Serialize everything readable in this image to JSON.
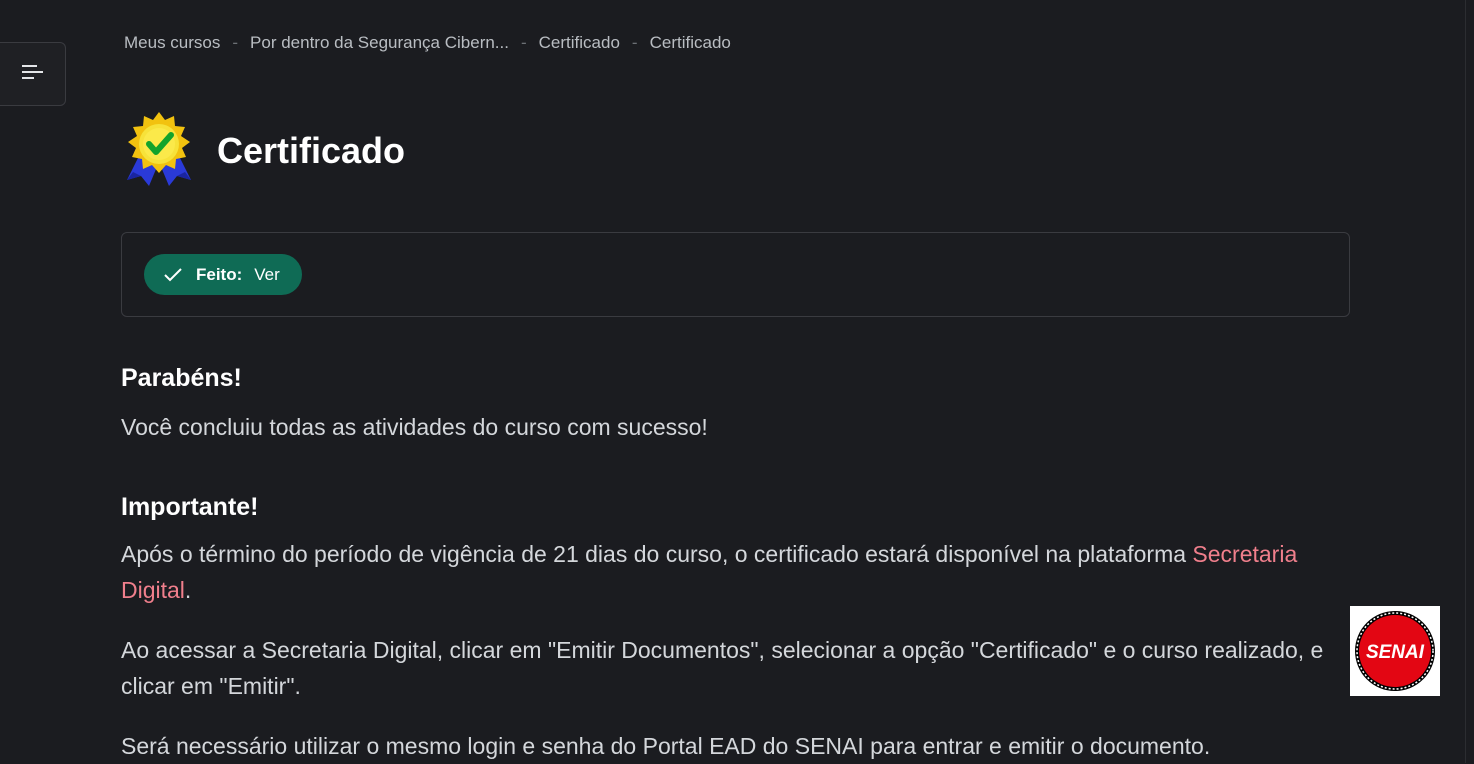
{
  "breadcrumb": {
    "items": [
      "Meus cursos",
      "Por dentro da Segurança Cibern...",
      "Certificado",
      "Certificado"
    ],
    "separator": "-"
  },
  "header": {
    "icon": "certificate-badge-icon",
    "title": "Certificado"
  },
  "completion": {
    "status_label": "Feito:",
    "status_value": "Ver",
    "badge_color": "#0f6b55"
  },
  "content": {
    "congrats_heading": "Parabéns!",
    "congrats_text": "Você concluiu todas as atividades do curso com sucesso!",
    "important_heading": "Importante!",
    "para1_before": "Após o término do período de vigência de 21 dias do curso, o certificado estará disponível na plataforma ",
    "para1_link": "Secretaria Digital",
    "para1_after": ".",
    "para2": "Ao acessar a Secretaria Digital, clicar em \"Emitir Documentos\", selecionar a opção \"Certificado\" e o curso realizado, e clicar em \"Emitir\".",
    "para3": "Será necessário utilizar o mesmo login e senha do Portal EAD do SENAI para entrar e emitir o documento."
  },
  "logo": {
    "text": "SENAI",
    "color": "#e30613"
  },
  "colors": {
    "background": "#1b1c20",
    "link": "#f07f8c"
  }
}
